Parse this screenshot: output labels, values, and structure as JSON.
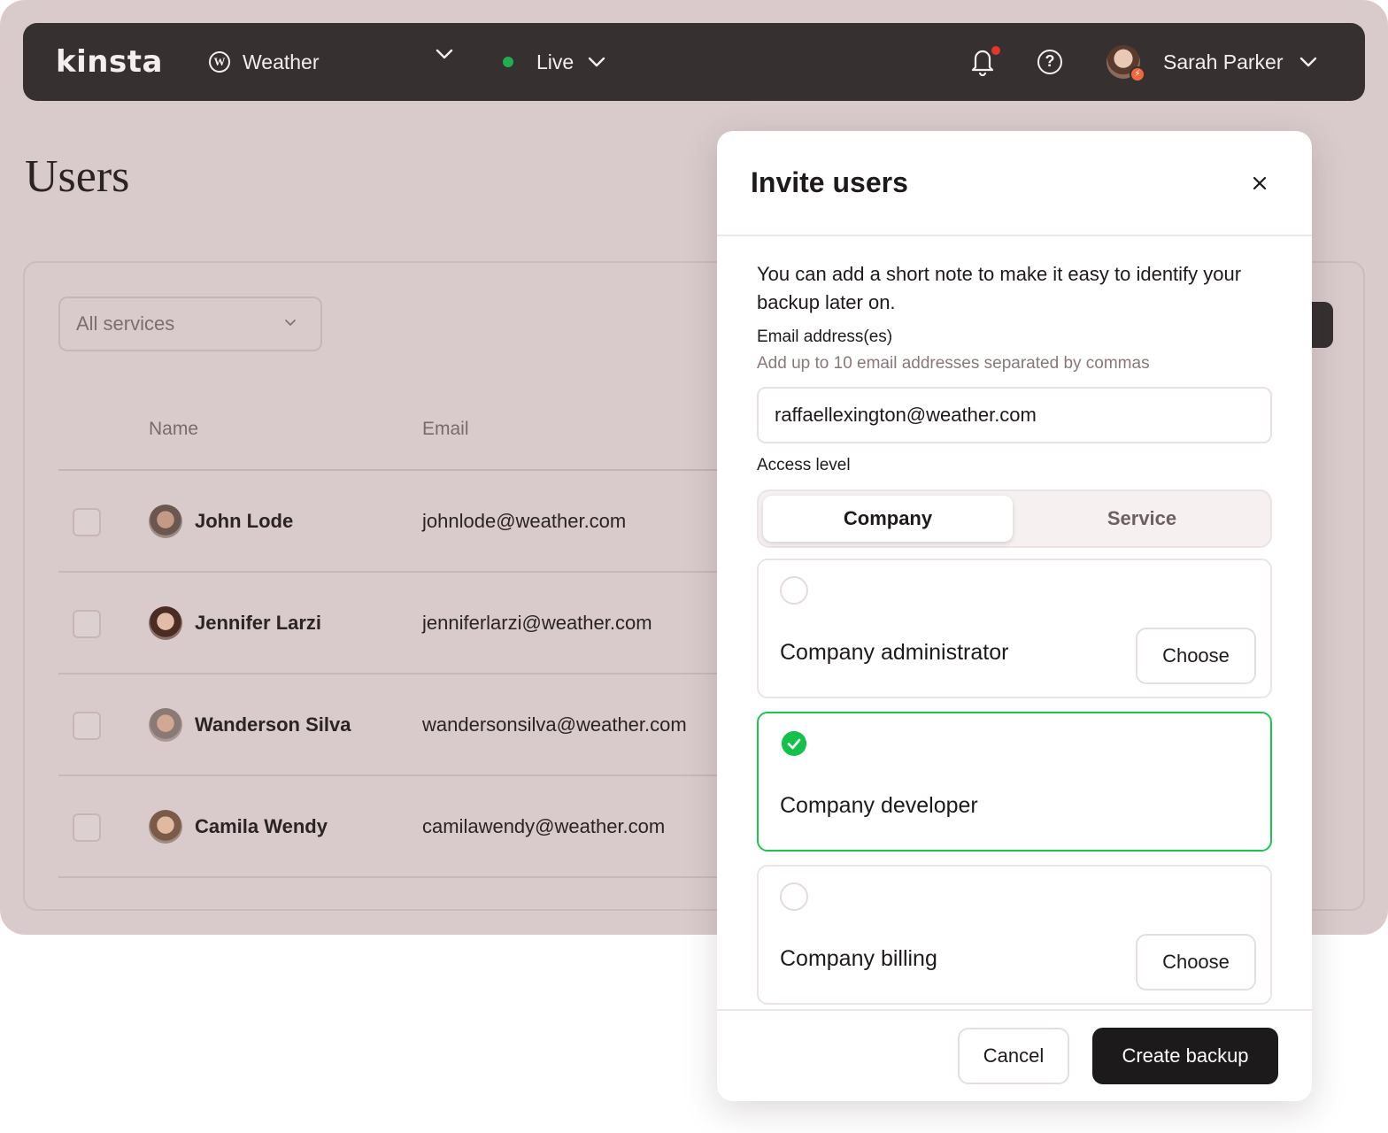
{
  "header": {
    "logo": "kinsta",
    "site_name": "Weather",
    "environment": "Live",
    "user_name": "Sarah Parker",
    "icons": {
      "site": "wordpress-icon",
      "notifications": "bell-icon",
      "help": "help-icon",
      "chevron": "chevron-down-icon"
    }
  },
  "page": {
    "title": "Users"
  },
  "users_panel": {
    "filter_value": "All services",
    "columns": [
      "Name",
      "Email"
    ],
    "rows": [
      {
        "name": "John Lode",
        "email": "johnlode@weather.com"
      },
      {
        "name": "Jennifer Larzi",
        "email": "jenniferlarzi@weather.com"
      },
      {
        "name": "Wanderson Silva",
        "email": "wandersonsilva@weather.com"
      },
      {
        "name": "Camila Wendy",
        "email": "camilawendy@weather.com"
      }
    ]
  },
  "modal": {
    "title": "Invite users",
    "note": "You can add a short note to make it easy to identify your backup later on.",
    "email_label": "Email address(es)",
    "email_hint": "Add up to 10 email addresses separated by commas",
    "email_value": "raffaellexington@weather.com",
    "access_label": "Access level",
    "tabs": {
      "active": "Company",
      "inactive": "Service"
    },
    "roles": [
      {
        "label": "Company administrator",
        "button": "Choose",
        "selected": false
      },
      {
        "label": "Company developer",
        "selected": true
      },
      {
        "label": "Company billing",
        "button": "Choose",
        "selected": false
      }
    ],
    "cancel_label": "Cancel",
    "submit_label": "Create backup"
  },
  "colors": {
    "background": "#d9cbcc",
    "topbar": "#363031",
    "accent_green": "#1fc44f",
    "notification_dot": "#e2372b",
    "primary_button": "#1c1a1a"
  }
}
